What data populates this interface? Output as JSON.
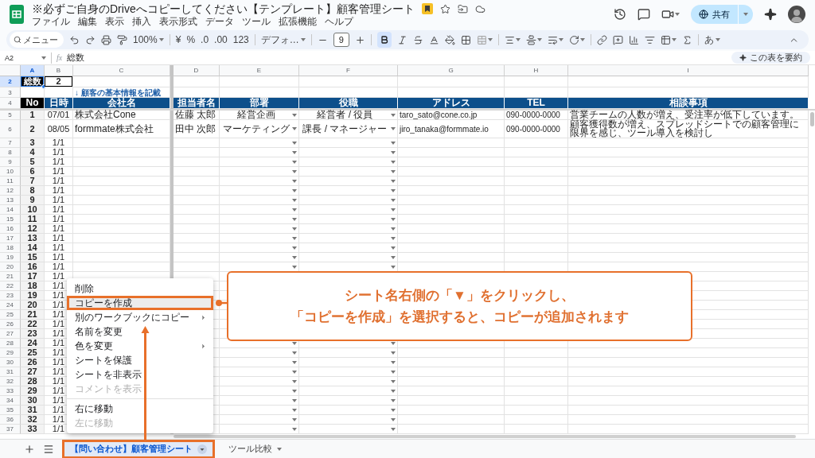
{
  "app": {
    "title": "※必ずご自身のDriveへコピーしてください【テンプレート】顧客管理シート",
    "menus": [
      "ファイル",
      "編集",
      "表示",
      "挿入",
      "表示形式",
      "データ",
      "ツール",
      "拡張機能",
      "ヘルプ"
    ],
    "share_label": "共有"
  },
  "toolbar": {
    "search_placeholder": "メニュー",
    "zoom": "100%",
    "currency": "¥",
    "percent": "%",
    "decrease_decimals": ".0",
    "increase_decimals": ".00",
    "number_format": "123",
    "font": "デフォ…",
    "font_size": "9",
    "bold_active": true,
    "input_tool": "あ"
  },
  "formula_bar": {
    "cell_ref": "A2",
    "fx": "fx",
    "content": "総数",
    "summary_button": "この表を要約"
  },
  "columns": [
    {
      "letter": "A",
      "selected": true
    },
    {
      "letter": "B",
      "selected": false
    },
    {
      "letter": "C",
      "selected": false
    },
    {
      "letter": "D",
      "selected": false
    },
    {
      "letter": "E",
      "selected": false
    },
    {
      "letter": "F",
      "selected": false
    },
    {
      "letter": "G",
      "selected": false
    },
    {
      "letter": "H",
      "selected": false
    },
    {
      "letter": "I",
      "selected": false
    }
  ],
  "rows": [
    {
      "num": "2",
      "kind": "total",
      "selected": true,
      "cells": [
        "総数",
        "2"
      ]
    },
    {
      "num": "3",
      "kind": "note",
      "selected": false,
      "note": "↓ 顧客の基本情報を記載"
    },
    {
      "num": "4",
      "kind": "header",
      "selected": false,
      "cells": [
        "No",
        "日時",
        "会社名",
        "担当者名",
        "部署",
        "役職",
        "アドレス",
        "TEL",
        "相談事項"
      ]
    },
    {
      "num": "5",
      "kind": "data",
      "selected": false,
      "dropdowns": true,
      "cells": [
        "1",
        "07/01",
        "株式会社Cone",
        "佐藤 太郎",
        "経営企画",
        "経営者 / 役員",
        "taro_sato@cone.co.jp",
        "090-0000-0000",
        "営業チームの人数が増え、受注率が低下しています。"
      ]
    },
    {
      "num": "6",
      "kind": "data",
      "selected": false,
      "dropdowns": true,
      "cells": [
        "2",
        "08/05",
        "formmate株式会社",
        "田中 次郎",
        "マーケティング",
        "課長 / マネージャー",
        "jiro_tanaka@formmate.io",
        "090-0000-0000",
        "顧客獲得数が増え、スプレッドシートでの顧客管理に限界を感じ、ツール導入を検討し"
      ]
    },
    {
      "num": "7",
      "kind": "data",
      "selected": false,
      "dropdowns": true,
      "cells": [
        "3",
        "1/1"
      ]
    },
    {
      "num": "8",
      "kind": "data",
      "selected": false,
      "dropdowns": true,
      "cells": [
        "4",
        "1/1"
      ]
    },
    {
      "num": "9",
      "kind": "data",
      "selected": false,
      "dropdowns": true,
      "cells": [
        "5",
        "1/1"
      ]
    },
    {
      "num": "10",
      "kind": "data",
      "selected": false,
      "dropdowns": true,
      "cells": [
        "6",
        "1/1"
      ]
    },
    {
      "num": "11",
      "kind": "data",
      "selected": false,
      "dropdowns": true,
      "cells": [
        "7",
        "1/1"
      ]
    },
    {
      "num": "12",
      "kind": "data",
      "selected": false,
      "dropdowns": true,
      "cells": [
        "8",
        "1/1"
      ]
    },
    {
      "num": "13",
      "kind": "data",
      "selected": false,
      "dropdowns": true,
      "cells": [
        "9",
        "1/1"
      ]
    },
    {
      "num": "14",
      "kind": "data",
      "selected": false,
      "dropdowns": true,
      "cells": [
        "10",
        "1/1"
      ]
    },
    {
      "num": "15",
      "kind": "data",
      "selected": false,
      "dropdowns": true,
      "cells": [
        "11",
        "1/1"
      ]
    },
    {
      "num": "16",
      "kind": "data",
      "selected": false,
      "dropdowns": true,
      "cells": [
        "12",
        "1/1"
      ]
    },
    {
      "num": "17",
      "kind": "data",
      "selected": false,
      "dropdowns": true,
      "cells": [
        "13",
        "1/1"
      ]
    },
    {
      "num": "18",
      "kind": "data",
      "selected": false,
      "dropdowns": true,
      "cells": [
        "14",
        "1/1"
      ]
    },
    {
      "num": "19",
      "kind": "data",
      "selected": false,
      "dropdowns": true,
      "cells": [
        "15",
        "1/1"
      ]
    },
    {
      "num": "20",
      "kind": "data",
      "selected": false,
      "dropdowns": true,
      "cells": [
        "16",
        "1/1"
      ]
    },
    {
      "num": "21",
      "kind": "data",
      "selected": false,
      "dropdowns": false,
      "cells": [
        "17",
        "1/1"
      ]
    },
    {
      "num": "22",
      "kind": "data",
      "selected": false,
      "dropdowns": false,
      "cells": [
        "18",
        "1/1"
      ]
    },
    {
      "num": "23",
      "kind": "data",
      "selected": false,
      "dropdowns": false,
      "cells": [
        "19",
        "1/1"
      ]
    },
    {
      "num": "24",
      "kind": "data",
      "selected": false,
      "dropdowns": false,
      "cells": [
        "20",
        "1/1"
      ]
    },
    {
      "num": "25",
      "kind": "data",
      "selected": false,
      "dropdowns": false,
      "cells": [
        "21",
        "1/1"
      ]
    },
    {
      "num": "26",
      "kind": "data",
      "selected": false,
      "dropdowns": false,
      "cells": [
        "22",
        "1/1"
      ]
    },
    {
      "num": "27",
      "kind": "data",
      "selected": false,
      "dropdowns": false,
      "cells": [
        "23",
        "1/1"
      ]
    },
    {
      "num": "28",
      "kind": "data",
      "selected": false,
      "dropdowns": true,
      "cells": [
        "24",
        "1/1"
      ]
    },
    {
      "num": "29",
      "kind": "data",
      "selected": false,
      "dropdowns": true,
      "cells": [
        "25",
        "1/1"
      ]
    },
    {
      "num": "30",
      "kind": "data",
      "selected": false,
      "dropdowns": true,
      "cells": [
        "26",
        "1/1"
      ]
    },
    {
      "num": "31",
      "kind": "data",
      "selected": false,
      "dropdowns": true,
      "cells": [
        "27",
        "1/1"
      ]
    },
    {
      "num": "32",
      "kind": "data",
      "selected": false,
      "dropdowns": true,
      "cells": [
        "28",
        "1/1"
      ]
    },
    {
      "num": "33",
      "kind": "data",
      "selected": false,
      "dropdowns": true,
      "cells": [
        "29",
        "1/1"
      ]
    },
    {
      "num": "34",
      "kind": "data",
      "selected": false,
      "dropdowns": true,
      "cells": [
        "30",
        "1/1"
      ]
    },
    {
      "num": "35",
      "kind": "data",
      "selected": false,
      "dropdowns": true,
      "cells": [
        "31",
        "1/1"
      ]
    },
    {
      "num": "36",
      "kind": "data",
      "selected": false,
      "dropdowns": true,
      "cells": [
        "32",
        "1/1"
      ]
    },
    {
      "num": "37",
      "kind": "data",
      "selected": false,
      "dropdowns": true,
      "cells": [
        "33",
        "1/1"
      ]
    }
  ],
  "context_menu": {
    "items": [
      {
        "kind": "item",
        "label": "削除",
        "submenu": false,
        "disabled": false,
        "selected": false
      },
      {
        "kind": "item",
        "label": "コピーを作成",
        "submenu": false,
        "disabled": false,
        "selected": true
      },
      {
        "kind": "item",
        "label": "別のワークブックにコピー",
        "submenu": true,
        "disabled": false,
        "selected": false
      },
      {
        "kind": "item",
        "label": "名前を変更",
        "submenu": false,
        "disabled": false,
        "selected": false
      },
      {
        "kind": "item",
        "label": "色を変更",
        "submenu": true,
        "disabled": false,
        "selected": false
      },
      {
        "kind": "item",
        "label": "シートを保護",
        "submenu": false,
        "disabled": false,
        "selected": false
      },
      {
        "kind": "item",
        "label": "シートを非表示",
        "submenu": false,
        "disabled": false,
        "selected": false
      },
      {
        "kind": "item",
        "label": "コメントを表示",
        "submenu": false,
        "disabled": true,
        "selected": false
      },
      {
        "kind": "divider"
      },
      {
        "kind": "item",
        "label": "右に移動",
        "submenu": false,
        "disabled": false,
        "selected": false
      },
      {
        "kind": "item",
        "label": "左に移動",
        "submenu": false,
        "disabled": true,
        "selected": false
      }
    ]
  },
  "callout": {
    "lines": [
      "シート名右側の「▼」をクリックし、",
      "「コピーを作成」を選択すると、コピーが追加されます"
    ]
  },
  "sheet_tabs": [
    {
      "label": "【問い合わせ】顧客管理シート",
      "selected": true
    },
    {
      "label": "ツール比較",
      "selected": false
    }
  ]
}
